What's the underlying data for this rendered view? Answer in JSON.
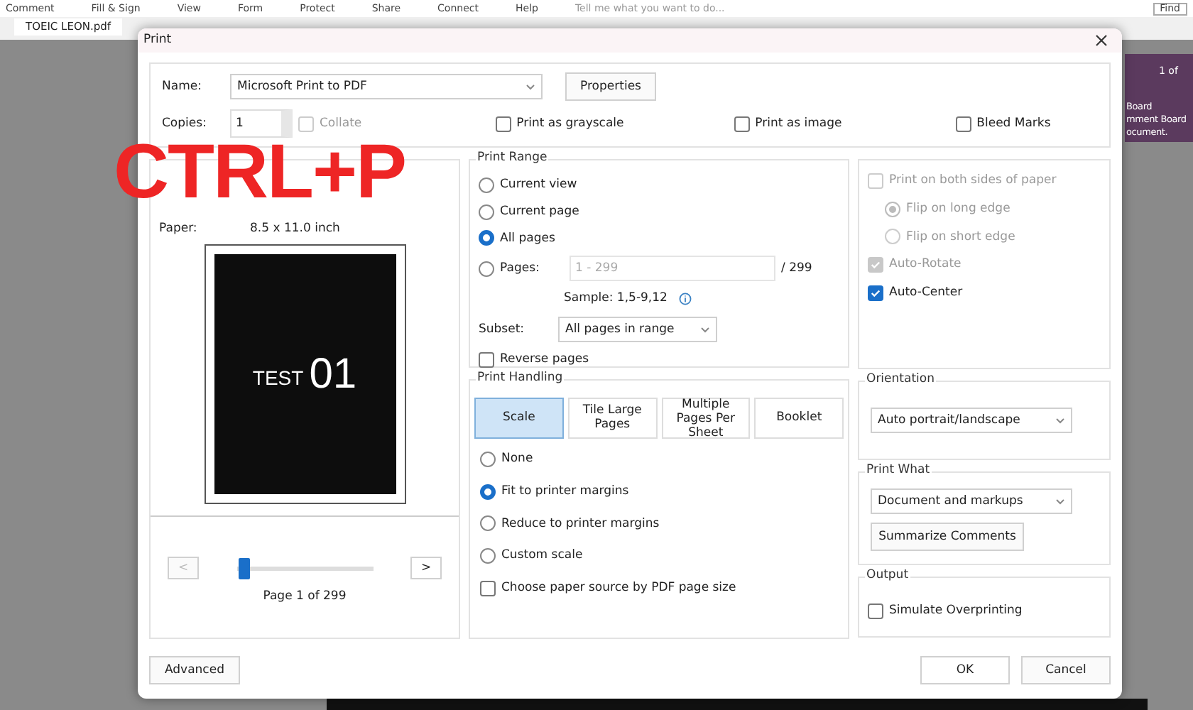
{
  "app": {
    "menu": [
      "Comment",
      "Fill & Sign",
      "View",
      "Form",
      "Protect",
      "Share",
      "Connect",
      "Help"
    ],
    "tell_me": "Tell me what you want to do...",
    "find": "Find",
    "tab": "TOEIC LEON.pdf",
    "side_panel": {
      "pager": "1 of",
      "lines": [
        "Board",
        "mment Board",
        "ocument."
      ]
    }
  },
  "overlay": "CTRL+P",
  "dialog": {
    "title": "Print",
    "printer": {
      "name_label": "Name:",
      "name": "Microsoft Print to PDF",
      "properties": "Properties",
      "copies_label": "Copies:",
      "copies": "1",
      "collate": {
        "label": "Collate",
        "checked": false,
        "disabled": true
      },
      "options": [
        {
          "label": "Print as grayscale",
          "checked": false
        },
        {
          "label": "Print as image",
          "checked": false
        },
        {
          "label": "Bleed Marks",
          "checked": false
        }
      ]
    },
    "preview": {
      "rows": [
        {
          "label": "Paper:",
          "value": "8.5 x 11.0 inch"
        }
      ],
      "cover_test": "TEST",
      "cover_number": "01",
      "prev": "<",
      "next": ">",
      "level": 0.02,
      "page": "Page 1 of 299"
    },
    "range": {
      "title": "Print Range",
      "options": [
        {
          "label": "Current view",
          "selected": false
        },
        {
          "label": "Current page",
          "selected": false
        },
        {
          "label": "All pages",
          "selected": true
        },
        {
          "label": "Pages:",
          "selected": false
        }
      ],
      "pages_placeholder": "1 - 299",
      "total": "/ 299",
      "sample": "Sample: 1,5-9,12",
      "subset_label": "Subset:",
      "subset": "All pages in range",
      "reverse": {
        "label": "Reverse pages",
        "checked": false
      }
    },
    "duplex": [
      {
        "kind": "check",
        "label": "Print on both sides of paper",
        "checked": false,
        "disabled": true
      },
      {
        "kind": "radio",
        "label": "Flip on long edge",
        "selected": true,
        "disabled": true
      },
      {
        "kind": "radio",
        "label": "Flip on short edge",
        "selected": false,
        "disabled": true
      },
      {
        "kind": "check",
        "label": "Auto-Rotate",
        "checked": true,
        "disabled": true
      },
      {
        "kind": "check",
        "label": "Auto-Center",
        "checked": true,
        "disabled": false
      }
    ],
    "handling": {
      "title": "Print Handling",
      "tabs": [
        {
          "label": "Scale",
          "selected": true
        },
        {
          "label": "Tile Large Pages",
          "selected": false
        },
        {
          "label": "Multiple Pages Per Sheet",
          "selected": false
        },
        {
          "label": "Booklet",
          "selected": false
        }
      ],
      "options": [
        {
          "label": "None",
          "selected": false
        },
        {
          "label": "Fit to printer margins",
          "selected": true
        },
        {
          "label": "Reduce to printer margins",
          "selected": false
        },
        {
          "label": "Custom scale",
          "selected": false
        }
      ],
      "paper_source": {
        "label": "Choose paper source by PDF page size",
        "checked": false
      }
    },
    "orientation": {
      "title": "Orientation",
      "value": "Auto portrait/landscape"
    },
    "print_what": {
      "title": "Print What",
      "value": "Document and markups",
      "summarize": "Summarize Comments"
    },
    "output": {
      "title": "Output",
      "simulate": {
        "label": "Simulate Overprinting",
        "checked": false
      }
    },
    "advanced": "Advanced",
    "ok": "OK",
    "cancel": "Cancel"
  }
}
